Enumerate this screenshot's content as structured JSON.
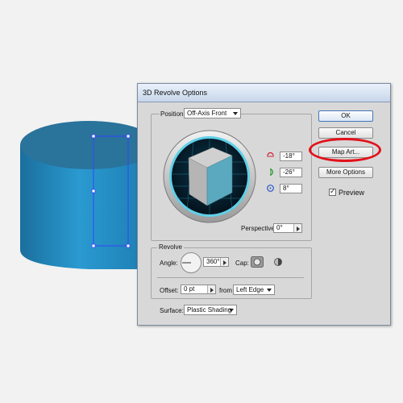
{
  "dialog": {
    "title": "3D Revolve Options",
    "position": {
      "label": "Position:",
      "value": "Off-Axis Front",
      "rot_x": "-18°",
      "rot_y": "-26°",
      "rot_z": "8°",
      "perspective_label": "Perspective:",
      "perspective_value": "0°"
    },
    "revolve": {
      "group_label": "Revolve",
      "angle_label": "Angle:",
      "angle_value": "360°",
      "cap_label": "Cap:",
      "offset_label": "Offset:",
      "offset_value": "0 pt",
      "from_label": "from",
      "from_value": "Left Edge"
    },
    "surface": {
      "label": "Surface:",
      "value": "Plastic Shading"
    },
    "buttons": {
      "ok": "OK",
      "cancel": "Cancel",
      "map_art": "Map Art...",
      "more_options": "More Options"
    },
    "preview": {
      "label": "Preview",
      "checked": true
    }
  },
  "colors": {
    "cylinder_body": "#1f7fb0",
    "cylinder_top": "#2c6f96",
    "selection": "#3344ff",
    "highlight": "#e3111a",
    "cube_face": "#5aa9bf"
  }
}
